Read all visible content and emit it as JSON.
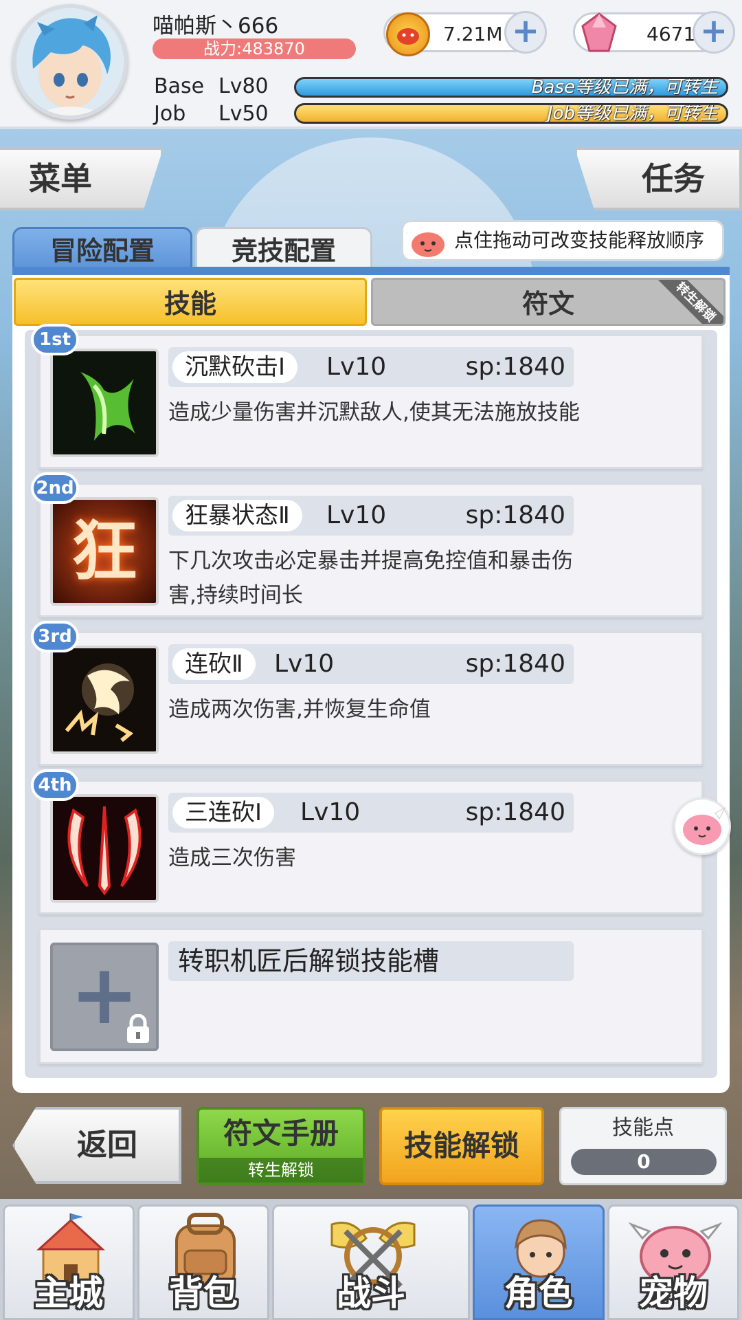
{
  "header": {
    "player_name": "喵帕斯丶666",
    "power": "战力:483870",
    "base_label": "Base",
    "base_level": "Lv80",
    "base_bar_text": "Base等级已满，可转生",
    "job_label": "Job",
    "job_level": "Lv50",
    "job_bar_text": "Job等级已满，可转生",
    "gold": "7.21M",
    "gems": "4671",
    "plus_symbol": "+"
  },
  "side_buttons": {
    "menu": "菜单",
    "tasks": "任务"
  },
  "config_tabs": {
    "adventure": "冒险配置",
    "pvp": "竞技配置"
  },
  "tip_text": "点住拖动可改变技能释放顺序",
  "sub_tabs": {
    "skill": "技能",
    "rune": "符文",
    "rune_ribbon": "转生解锁"
  },
  "skills": [
    {
      "badge": "1st",
      "name": "沉默砍击Ⅰ",
      "level": "Lv10",
      "sp": "sp:1840",
      "desc": "造成少量伤害并沉默敌人,使其无法施放技能",
      "icon": "green-claw-icon"
    },
    {
      "badge": "2nd",
      "name": "狂暴状态Ⅱ",
      "level": "Lv10",
      "sp": "sp:1840",
      "desc": "下几次攻击必定暴击并提高免控值和暴击伤害,持续时间长",
      "icon": "berserk-icon",
      "icon_glyph": "狂"
    },
    {
      "badge": "3rd",
      "name": "连砍Ⅱ",
      "level": "Lv10",
      "sp": "sp:1840",
      "desc": "造成两次伤害,并恢复生命值",
      "icon": "double-slash-icon"
    },
    {
      "badge": "4th",
      "name": "三连砍Ⅰ",
      "level": "Lv10",
      "sp": "sp:1840",
      "desc": "造成三次伤害",
      "icon": "triple-slash-icon"
    }
  ],
  "locked_slot": {
    "text": "转职机匠后解锁技能槽",
    "plus": "+"
  },
  "bottom_buttons": {
    "back": "返回",
    "rune_book": "符文手册",
    "rune_book_sub": "转生解锁",
    "skill_unlock": "技能解锁",
    "skill_points_label": "技能点",
    "skill_points": "0"
  },
  "nav": [
    {
      "label": "主城",
      "icon": "castle-icon"
    },
    {
      "label": "背包",
      "icon": "backpack-icon"
    },
    {
      "label": "战斗",
      "icon": "crossed-swords-icon"
    },
    {
      "label": "角色",
      "icon": "character-icon",
      "active": true
    },
    {
      "label": "宠物",
      "icon": "pet-icon"
    }
  ],
  "colors": {
    "accent": "#4f87d0",
    "gold_button": "#f6c02c",
    "green_button": "#5aaa25",
    "power_badge": "#f07a7a"
  }
}
